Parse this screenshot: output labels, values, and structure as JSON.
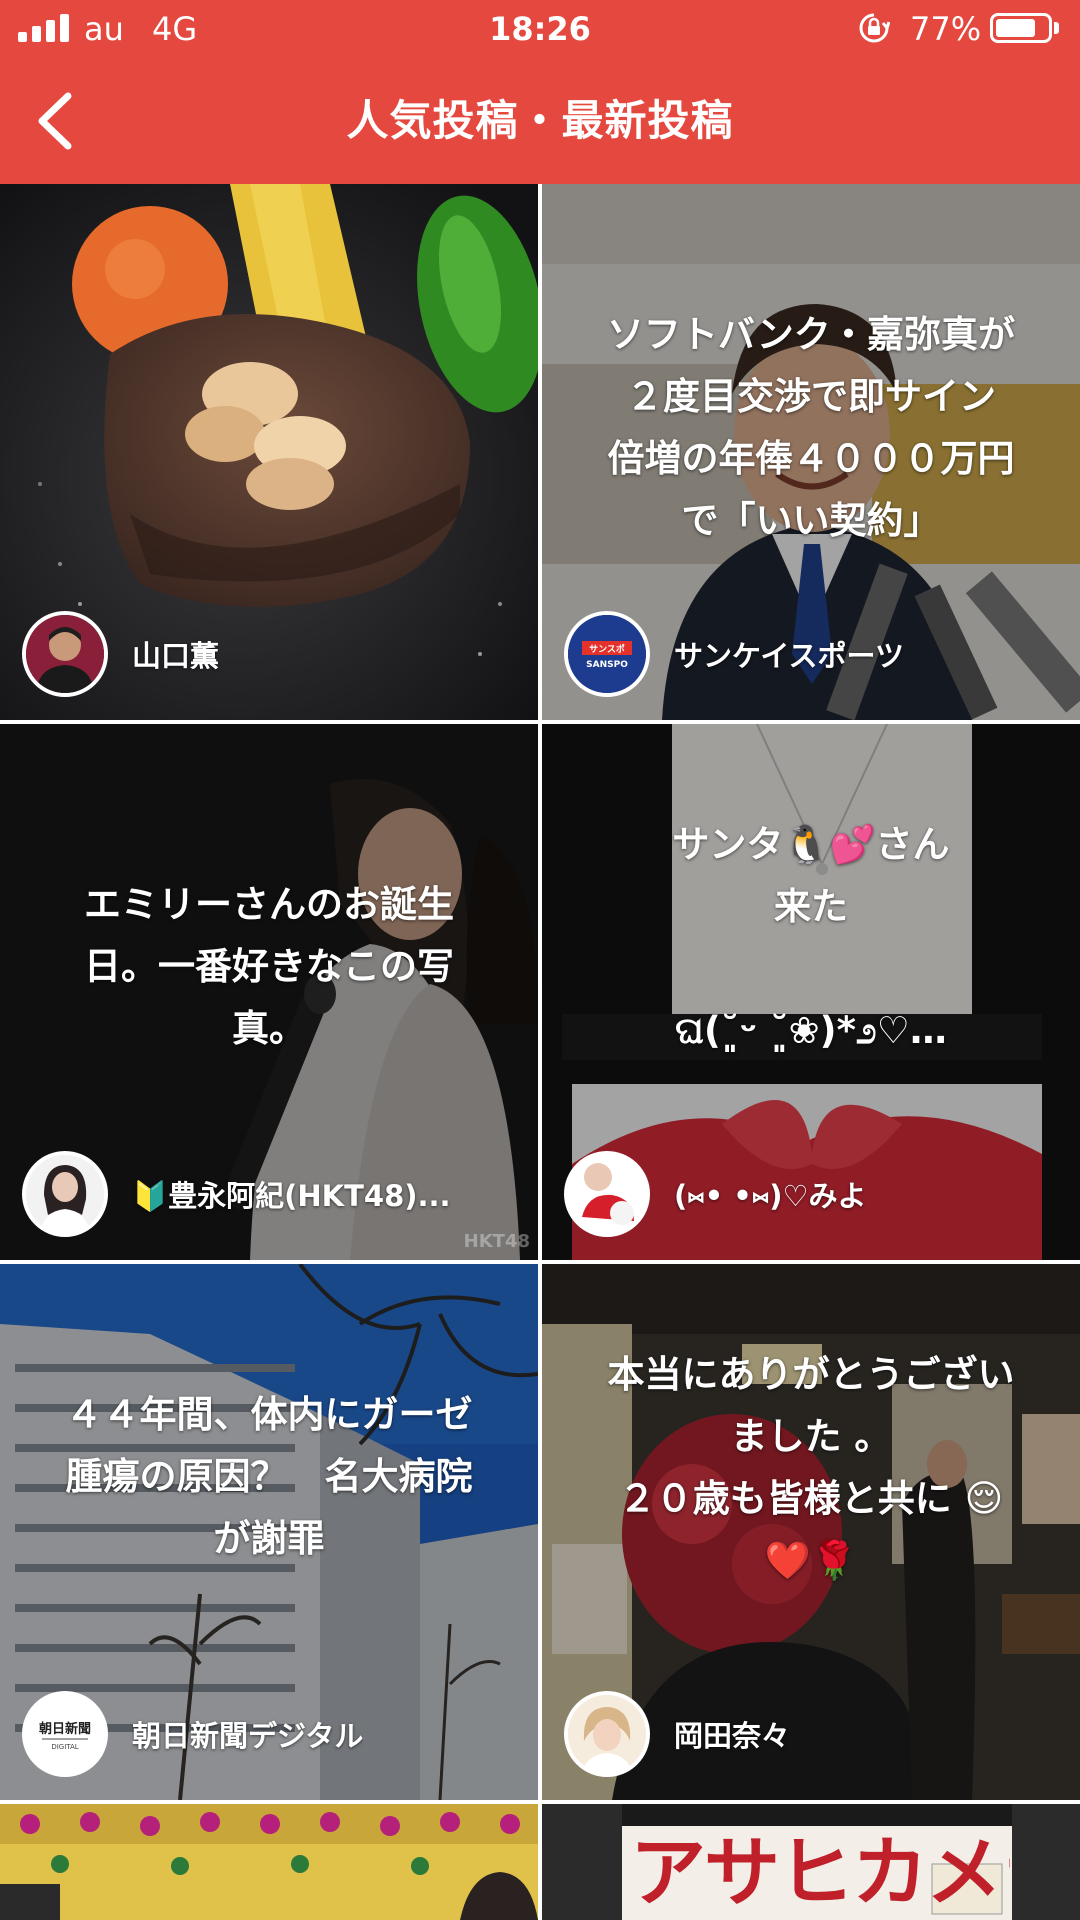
{
  "status_bar": {
    "carrier": "au",
    "network": "4G",
    "time": "18:26",
    "battery_percent": "77%",
    "battery_level": 0.77,
    "signal_bars": 4,
    "orientation_lock_icon": "orientation-lock-icon"
  },
  "header": {
    "title": "人気投稿・最新投稿",
    "back_icon": "chevron-left-icon",
    "color": "#e4483e"
  },
  "posts": [
    {
      "caption": "",
      "author": "山口薫"
    },
    {
      "caption": "ソフトバンク・嘉弥真が\n２度目交渉で即サイン\n倍増の年俸４０００万円\nで「いい契約」",
      "author": "サンケイスポーツ",
      "avatar_label": "サンスポ SANSPO"
    },
    {
      "caption": "エミリーさんのお誕生\n日。一番好きなこの写\n真。",
      "author": "🔰豊永阿紀(HKT48)...",
      "watermark": "HKT48"
    },
    {
      "caption": "サンタ🐧💕さん\n来た\n\nଘ(˘͈ᵕ ˘͈❀)*೨♡…",
      "author": "(⑅• •⑅)♡みよ"
    },
    {
      "caption": "４４年間、体内にガーゼ\n腫瘍の原因？　名大病院\nが謝罪",
      "author": "朝日新聞デジタル",
      "avatar_label": "朝日新聞 DIGITAL"
    },
    {
      "caption": "本当にありがとうござい\nました 。\n２０歳も皆様と共に 😌\n❤️🌹",
      "author": "岡田奈々"
    },
    {
      "caption": "",
      "author": ""
    },
    {
      "caption": "",
      "author": "",
      "magazine_title": "アサヒカメラ"
    }
  ]
}
